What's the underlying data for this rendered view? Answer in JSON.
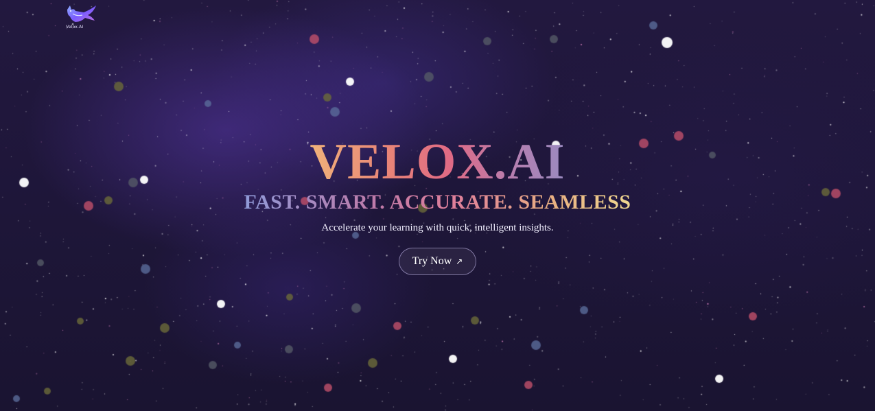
{
  "brand": {
    "logo_icon": "fox-icon",
    "logo_text": "Velox.AI"
  },
  "hero": {
    "title": "VELOX.AI",
    "tagline": "FAST. SMART. ACCURATE. SEAMLESS",
    "subtitle": "Accelerate your learning with quick, intelligent insights.",
    "cta_label": "Try Now",
    "cta_icon": "arrow-up-right-icon",
    "cta_icon_glyph": "↗"
  },
  "colors": {
    "background": "#1e1639",
    "nebula": "#5838aa",
    "title_gradient": [
      "#f0b27a",
      "#e06a85",
      "#9a8ac0"
    ],
    "tagline_gradient": [
      "#8f9ad8",
      "#e0809a",
      "#f0d890"
    ],
    "particle_colors": [
      "#ffffff",
      "#c0506a",
      "#5a6b9a",
      "#6b6a3a",
      "#555a66"
    ]
  }
}
